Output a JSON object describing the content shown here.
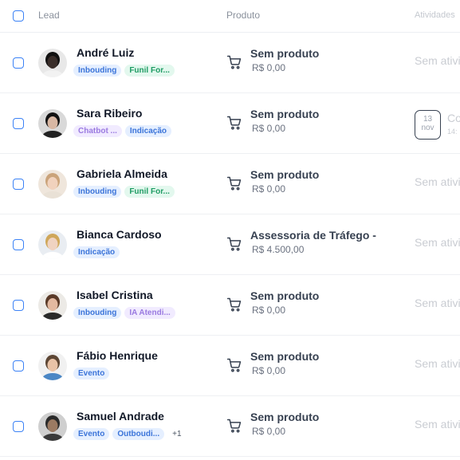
{
  "header": {
    "lead": "Lead",
    "produto": "Produto",
    "atividades": "Atividades"
  },
  "rows": [
    {
      "name": "André Luiz",
      "tags": [
        {
          "label": "Inbouding",
          "color": "blue"
        },
        {
          "label": "Funil For...",
          "color": "green"
        }
      ],
      "more": "",
      "product": "Sem produto",
      "price": "R$ 0,00",
      "activity": "Sem ativi"
    },
    {
      "name": "Sara Ribeiro",
      "tags": [
        {
          "label": "Chatbot ...",
          "color": "purple"
        },
        {
          "label": "Indicação",
          "color": "blue"
        }
      ],
      "more": "",
      "product": "Sem produto",
      "price": "R$ 0,00",
      "activity": "",
      "activity_date": {
        "day": "13",
        "month": "nov"
      },
      "activity_title": "Co",
      "activity_sub": "14:"
    },
    {
      "name": "Gabriela Almeida",
      "tags": [
        {
          "label": "Inbouding",
          "color": "blue"
        },
        {
          "label": "Funil For...",
          "color": "green"
        }
      ],
      "more": "",
      "product": "Sem produto",
      "price": "R$ 0,00",
      "activity": "Sem ativi"
    },
    {
      "name": "Bianca Cardoso",
      "tags": [
        {
          "label": "Indicação",
          "color": "blue"
        }
      ],
      "more": "",
      "product": "Assessoria de Tráfego -",
      "price": "R$ 4.500,00",
      "activity": "Sem ativi"
    },
    {
      "name": "Isabel Cristina",
      "tags": [
        {
          "label": "Inbouding",
          "color": "blue"
        },
        {
          "label": "IA Atendi...",
          "color": "purple"
        }
      ],
      "more": "",
      "product": "Sem produto",
      "price": "R$ 0,00",
      "activity": "Sem ativi"
    },
    {
      "name": "Fábio Henrique",
      "tags": [
        {
          "label": "Evento",
          "color": "blue"
        }
      ],
      "more": "",
      "product": "Sem produto",
      "price": "R$ 0,00",
      "activity": "Sem ativi"
    },
    {
      "name": "Samuel Andrade",
      "tags": [
        {
          "label": "Evento",
          "color": "blue"
        },
        {
          "label": "Outboudi...",
          "color": "blue"
        }
      ],
      "more": "+1",
      "product": "Sem produto",
      "price": "R$ 0,00",
      "activity": "Sem ativi"
    }
  ],
  "colors": {
    "accent": "#3b82f6",
    "tag_blue": "#3b74d9",
    "tag_green": "#1f9c64",
    "tag_purple": "#9a7ae0"
  },
  "icons": {
    "cart": "shopping-cart-icon",
    "avatar": "avatar-photo"
  }
}
